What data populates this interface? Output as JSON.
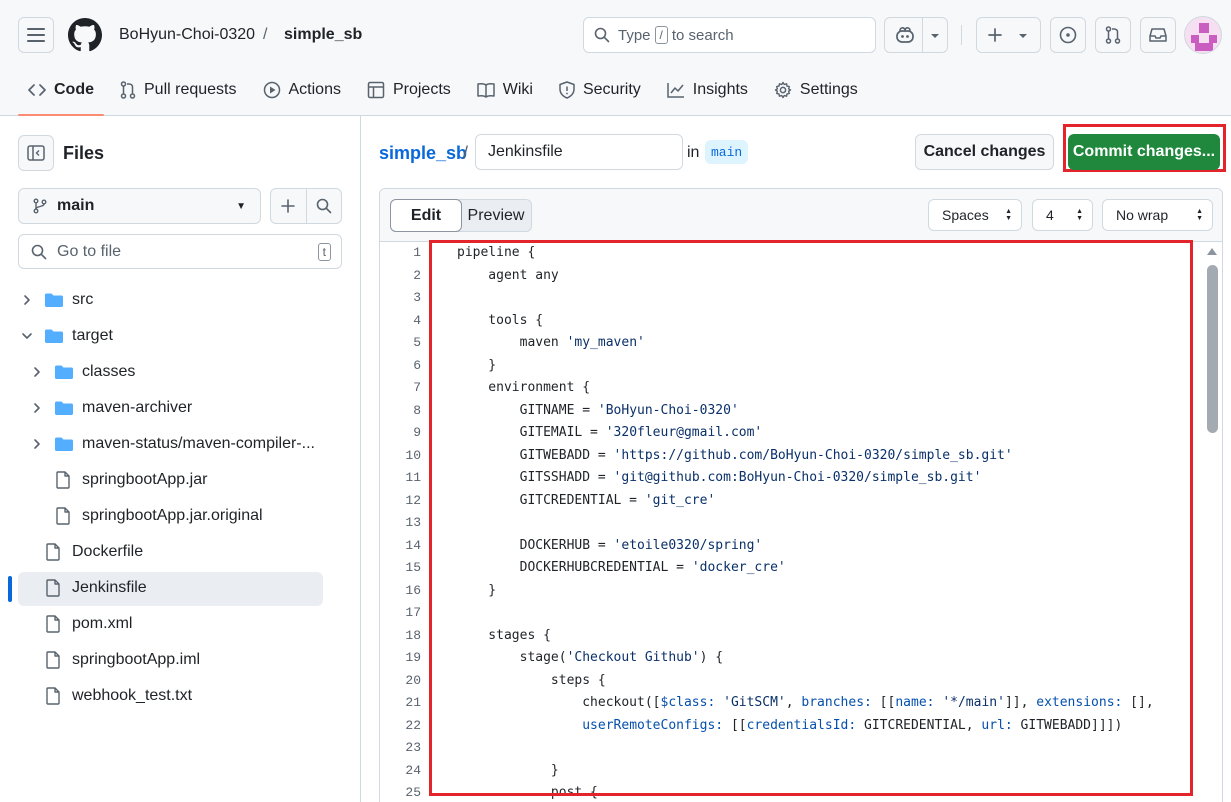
{
  "header": {
    "owner": "BoHyun-Choi-0320",
    "separator": "/",
    "repo": "simple_sb",
    "search_prefix": "Type",
    "search_key": "/",
    "search_suffix": "to search"
  },
  "tabs": [
    {
      "label": "Code",
      "icon": "code-icon",
      "active": true
    },
    {
      "label": "Pull requests",
      "icon": "pull-request-icon"
    },
    {
      "label": "Actions",
      "icon": "play-icon"
    },
    {
      "label": "Projects",
      "icon": "table-icon"
    },
    {
      "label": "Wiki",
      "icon": "book-icon"
    },
    {
      "label": "Security",
      "icon": "shield-icon"
    },
    {
      "label": "Insights",
      "icon": "graph-icon"
    },
    {
      "label": "Settings",
      "icon": "gear-icon"
    }
  ],
  "sidebar": {
    "title": "Files",
    "branch": "main",
    "goto_placeholder": "Go to file",
    "goto_key": "t",
    "tree": [
      {
        "label": "src",
        "type": "folder",
        "depth": 0,
        "expanded": false
      },
      {
        "label": "target",
        "type": "folder",
        "depth": 0,
        "expanded": true
      },
      {
        "label": "classes",
        "type": "folder",
        "depth": 1,
        "expanded": false
      },
      {
        "label": "maven-archiver",
        "type": "folder",
        "depth": 1,
        "expanded": false
      },
      {
        "label": "maven-status/maven-compiler-...",
        "type": "folder",
        "depth": 1,
        "expanded": false
      },
      {
        "label": "springbootApp.jar",
        "type": "file",
        "depth": 1
      },
      {
        "label": "springbootApp.jar.original",
        "type": "file",
        "depth": 1
      },
      {
        "label": "Dockerfile",
        "type": "file",
        "depth": 0
      },
      {
        "label": "Jenkinsfile",
        "type": "file",
        "depth": 0,
        "selected": true
      },
      {
        "label": "pom.xml",
        "type": "file",
        "depth": 0
      },
      {
        "label": "springbootApp.iml",
        "type": "file",
        "depth": 0
      },
      {
        "label": "webhook_test.txt",
        "type": "file",
        "depth": 0
      }
    ]
  },
  "editor": {
    "repo_link": "simple_sb",
    "slash": "/",
    "filename": "Jenkinsfile",
    "in_label": "in",
    "branch": "main",
    "cancel_label": "Cancel changes",
    "commit_label": "Commit changes...",
    "edit_tab": "Edit",
    "preview_tab": "Preview",
    "indent_mode": "Spaces",
    "indent_size": "4",
    "wrap_mode": "No wrap",
    "line_numbers": [
      "1",
      "2",
      "3",
      "4",
      "5",
      "6",
      "7",
      "8",
      "9",
      "10",
      "11",
      "12",
      "13",
      "14",
      "15",
      "16",
      "17",
      "18",
      "19",
      "20",
      "21",
      "22",
      "23",
      "24",
      "25"
    ],
    "lines": [
      "pipeline {",
      "    agent any",
      "",
      "    tools {",
      "        maven 'my_maven'",
      "    }",
      "    environment {",
      "        GITNAME = 'BoHyun-Choi-0320'",
      "        GITEMAIL = '320fleur@gmail.com'",
      "        GITWEBADD = 'https://github.com/BoHyun-Choi-0320/simple_sb.git'",
      "        GITSSHADD = 'git@github.com:BoHyun-Choi-0320/simple_sb.git'",
      "        GITCREDENTIAL = 'git_cre'",
      "",
      "        DOCKERHUB = 'etoile0320/spring'",
      "        DOCKERHUBCREDENTIAL = 'docker_cre'",
      "    }",
      "",
      "    stages {",
      "        stage('Checkout Github') {",
      "            steps {",
      "                checkout([$class: 'GitSCM', branches: [[name: '*/main']], extensions: [],",
      "                userRemoteConfigs: [[credentialsId: GITCREDENTIAL, url: GITWEBADD]]])",
      "",
      "            }",
      "            post {"
    ]
  },
  "colors": {
    "accent": "#0969da",
    "commit_green": "#1f883d",
    "highlight_red": "#e3242b",
    "tab_underline": "#fd8c73"
  }
}
